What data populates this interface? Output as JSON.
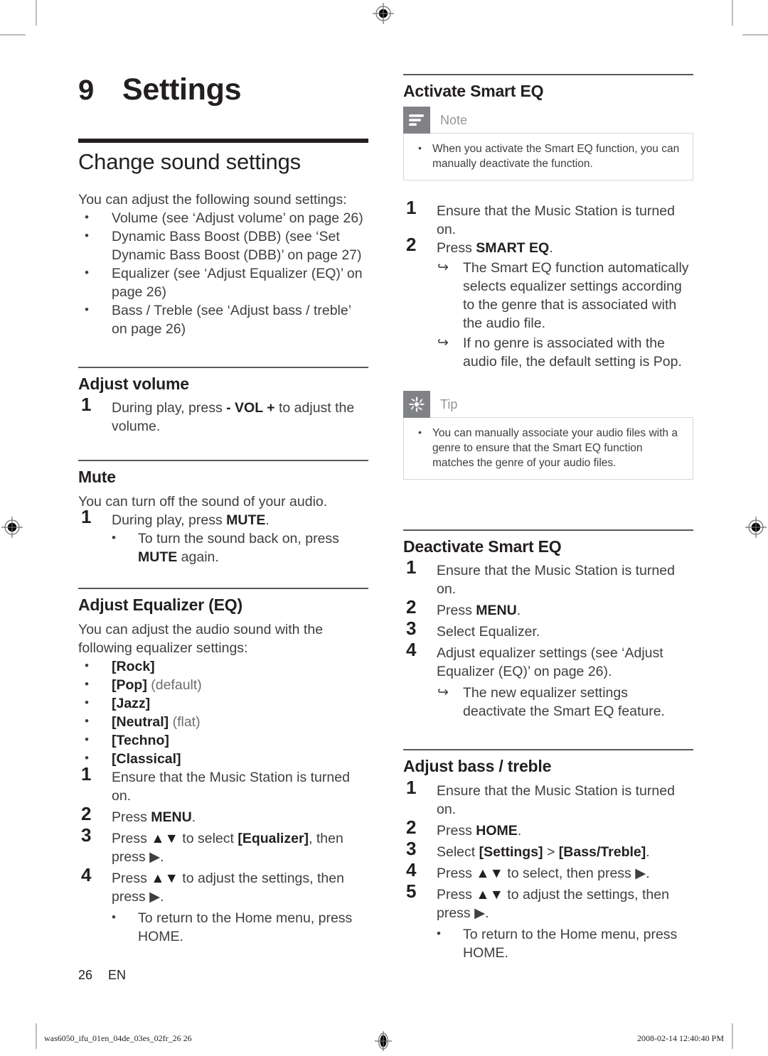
{
  "chapter": {
    "number": "9",
    "title": "Settings"
  },
  "left_column": {
    "section_title": "Change sound settings",
    "intro": "You can adjust the following sound settings:",
    "sound_settings": [
      "Volume (see ‘Adjust volume’ on page 26)",
      "Dynamic Bass Boost (DBB) (see ‘Set Dynamic Bass Boost (DBB)’ on page 27)",
      "Equalizer (see ‘Adjust Equalizer (EQ)’ on page 26)",
      "Bass / Treble (see ‘Adjust bass / treble’ on page 26)"
    ],
    "adjust_volume": {
      "heading": "Adjust volume",
      "step1_pre": "During play, press ",
      "step1_key": "- VOL +",
      "step1_post": " to adjust the volume."
    },
    "mute": {
      "heading": "Mute",
      "intro": "You can turn off the sound of your audio.",
      "step1_pre": "During play, press ",
      "step1_key": "MUTE",
      "step1_post": ".",
      "sub_pre": "To turn the sound back on, press ",
      "sub_key": "MUTE",
      "sub_post": " again."
    },
    "adjust_eq": {
      "heading": "Adjust Equalizer (EQ)",
      "intro": "You can adjust the audio sound with the following equalizer settings:",
      "presets": [
        {
          "name": "[Rock]",
          "note": ""
        },
        {
          "name": "[Pop]",
          "note": " (default)"
        },
        {
          "name": "[Jazz]",
          "note": ""
        },
        {
          "name": "[Neutral]",
          "note": " (flat)"
        },
        {
          "name": "[Techno]",
          "note": ""
        },
        {
          "name": "[Classical]",
          "note": ""
        }
      ],
      "step1": "Ensure that the Music Station is turned on.",
      "step2_pre": "Press ",
      "step2_key": "MENU",
      "step2_post": ".",
      "step3_pre": "Press ",
      "step3_arrows": "▲▼",
      "step3_mid": " to select ",
      "step3_target": "[Equalizer]",
      "step3_post": ", then press ▶.",
      "step4_pre": "Press ",
      "step4_arrows": "▲▼",
      "step4_post": " to adjust the settings, then press ▶.",
      "sub_pre": "To return to the Home menu, press ",
      "sub_key": "HOME",
      "sub_post": "."
    }
  },
  "right_column": {
    "activate_smart_eq": {
      "heading": "Activate Smart EQ",
      "note": {
        "icon": "note-lines-icon",
        "label": "Note",
        "items": [
          "When you activate the Smart EQ function, you can manually deactivate the function."
        ]
      },
      "step1": "Ensure that the Music Station is turned on.",
      "step2_pre": "Press ",
      "step2_key": "SMART EQ",
      "step2_post": ".",
      "results": [
        "The Smart EQ function automatically selects equalizer settings according to the genre that is associated with the audio file.",
        "If no genre is associated with the audio file, the default setting is Pop."
      ],
      "tip": {
        "icon": "tip-asterisk-icon",
        "label": "Tip",
        "items": [
          "You can manually associate your audio files with a genre to ensure that the Smart EQ function matches the genre of your audio files."
        ]
      }
    },
    "deactivate_smart_eq": {
      "heading": "Deactivate Smart EQ",
      "step1": "Ensure that the Music Station is turned on.",
      "step2_pre": "Press ",
      "step2_key": "MENU",
      "step2_post": ".",
      "step3": "Select Equalizer.",
      "step4": "Adjust equalizer settings (see ‘Adjust Equalizer (EQ)’ on page 26).",
      "result": "The new equalizer settings deactivate the Smart EQ feature."
    },
    "adjust_bass_treble": {
      "heading": "Adjust bass / treble",
      "step1": "Ensure that the Music Station is turned on.",
      "step2_pre": "Press ",
      "step2_key": "HOME",
      "step2_post": ".",
      "step3_pre": "Select ",
      "step3_a": "[Settings]",
      "step3_mid": " > ",
      "step3_b": "[Bass/Treble]",
      "step3_post": ".",
      "step4_pre": "Press ",
      "step4_arrows": "▲▼",
      "step4_post": " to select, then press ▶.",
      "step5_pre": "Press ",
      "step5_arrows": "▲▼",
      "step5_post": " to adjust the settings, then press ▶.",
      "sub_pre": "To return to the Home menu, press ",
      "sub_key": "HOME",
      "sub_post": "."
    }
  },
  "folio": {
    "page_number": "26",
    "language": "EN"
  },
  "footer": {
    "job_name": "was6050_ifu_01en_04de_03es_02fr_26   26",
    "timestamp": "2008-02-14   12:40:40 PM"
  },
  "colors": {
    "rule_major": "#231f20",
    "rule_minor": "#58595b",
    "callout_icon_bg": "#808285",
    "callout_label": "#939598",
    "body_text": "#3f3f42"
  }
}
